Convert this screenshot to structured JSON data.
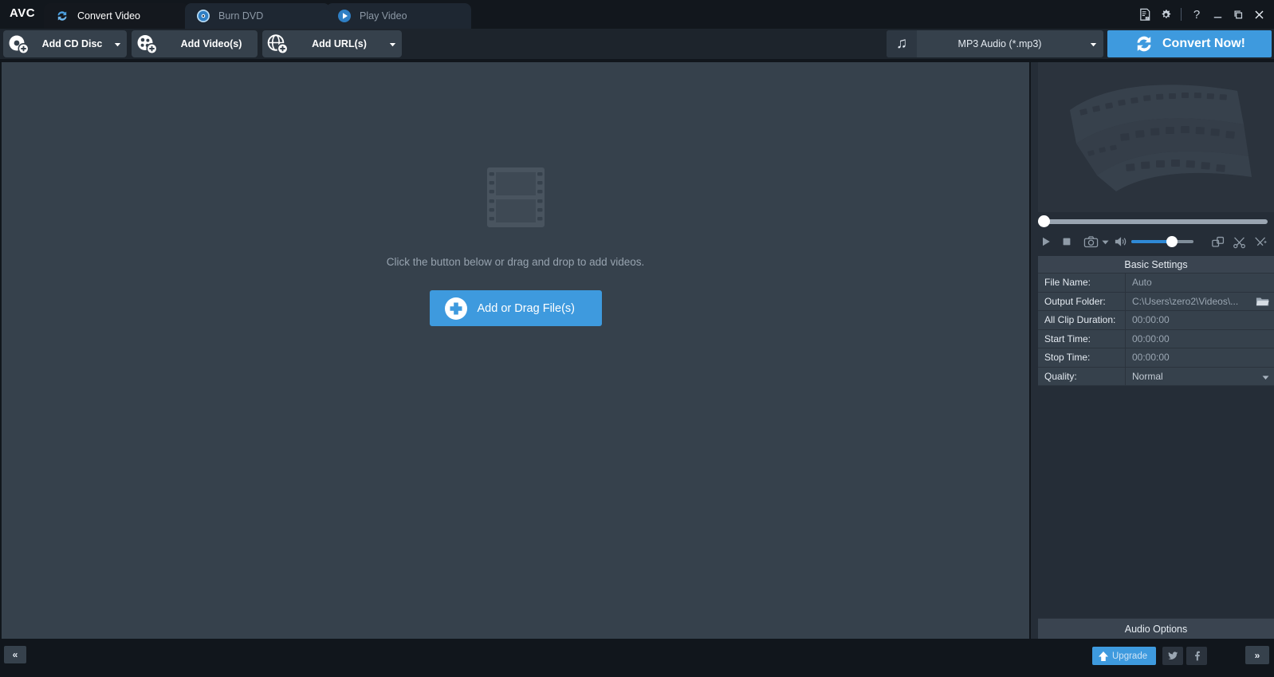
{
  "app": {
    "logo": "AVC"
  },
  "titlebar": {
    "tabs": [
      {
        "label": "Convert Video",
        "icon": "convert-icon",
        "active": true
      },
      {
        "label": "Burn DVD",
        "icon": "disc-icon",
        "active": false
      },
      {
        "label": "Play Video",
        "icon": "play-circle-icon",
        "active": false
      }
    ],
    "buttons": [
      {
        "name": "log-icon",
        "title": "Log"
      },
      {
        "name": "gear-icon",
        "title": "Settings"
      },
      {
        "name": "help-icon",
        "title": "?"
      },
      {
        "name": "minimize-icon",
        "title": "Minimize"
      },
      {
        "name": "restore-icon",
        "title": "Restore"
      },
      {
        "name": "close-icon",
        "title": "Close"
      }
    ],
    "help_glyph": "?"
  },
  "toolbar": {
    "add_cd_disc": "Add CD Disc",
    "add_videos": "Add Video(s)",
    "add_urls": "Add URL(s)",
    "output_format": "MP3 Audio (*.mp3)",
    "convert_now": "Convert Now!",
    "accent_color": "#3e9ade"
  },
  "canvas": {
    "hint_text": "Click the button below or drag and drop to add videos.",
    "add_button_label": "Add or Drag File(s)"
  },
  "right_panel": {
    "seek_position_percent": 0,
    "volume_percent": 64,
    "player_controls": [
      {
        "name": "play-icon"
      },
      {
        "name": "stop-icon"
      },
      {
        "name": "snapshot-icon"
      },
      {
        "name": "chevron-down-icon"
      },
      {
        "name": "volume-icon"
      },
      {
        "name": "merge-icon"
      },
      {
        "name": "cut-icon"
      },
      {
        "name": "effects-icon"
      }
    ],
    "settings": {
      "title": "Basic Settings",
      "rows": [
        {
          "label": "File Name:",
          "value": "Auto"
        },
        {
          "label": "Output Folder:",
          "value": "C:\\Users\\zero2\\Videos\\..."
        },
        {
          "label": "All Clip Duration:",
          "value": "00:00:00"
        },
        {
          "label": "Start Time:",
          "value": "00:00:00"
        },
        {
          "label": "Stop Time:",
          "value": "00:00:00"
        },
        {
          "label": "Quality:",
          "value": "Normal"
        }
      ]
    },
    "audio_options": "Audio Options"
  },
  "bottombar": {
    "collapse_left": "«",
    "upgrade": "Upgrade",
    "collapse_right": "»",
    "twitter": "twitter-icon",
    "facebook": "facebook-icon"
  }
}
